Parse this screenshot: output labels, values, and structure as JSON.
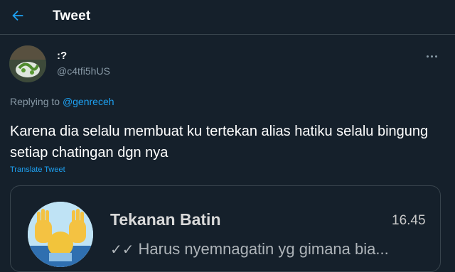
{
  "header": {
    "title": "Tweet",
    "back_icon": "arrow-left-icon"
  },
  "tweet": {
    "display_name": ":?",
    "handle": "@c4tfi5hUS",
    "replying_prefix": "Replying to",
    "replying_to": "@genreceh",
    "text": "Karena dia selalu membuat ku tertekan alias hatiku selalu bingung setiap chatingan dgn nya",
    "translate_label": "Translate Tweet"
  },
  "attached_card": {
    "chat_title": "Tekanan Batin",
    "time": "16.45",
    "read_icon": "double-check-icon",
    "preview_text": "Harus nyemnagatin yg gimana bia..."
  },
  "colors": {
    "background": "#15202b",
    "accent": "#1da1f2",
    "muted_text": "#8899a6",
    "border": "#38444d"
  }
}
